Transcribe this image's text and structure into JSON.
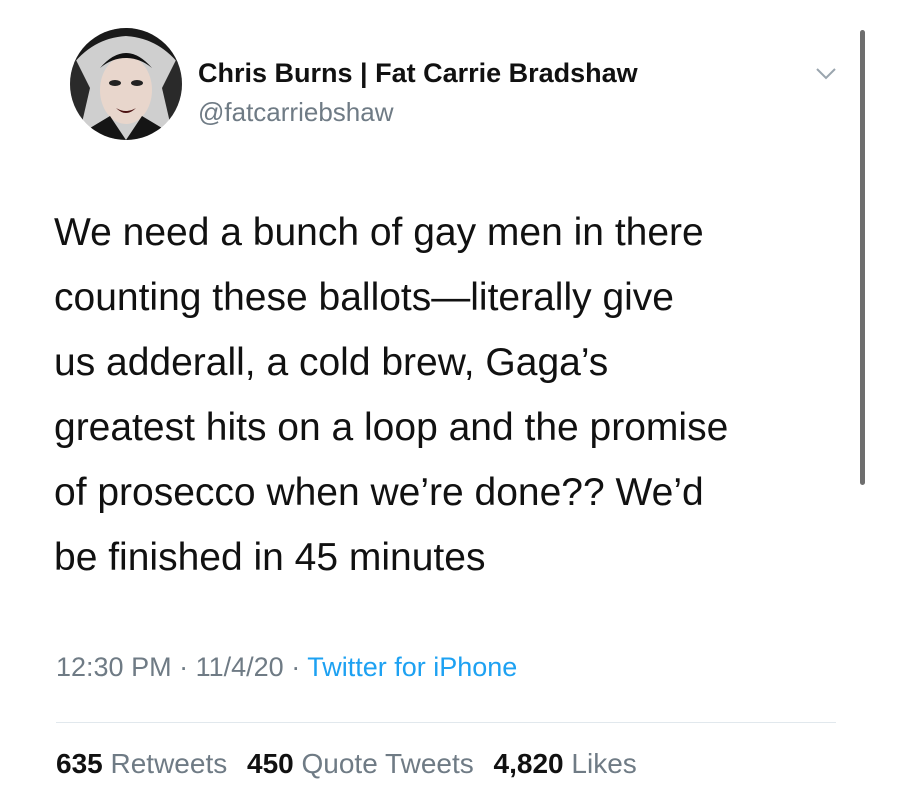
{
  "author": {
    "display_name": "Chris Burns | Fat Carrie Bradshaw",
    "handle": "@fatcarriebshaw"
  },
  "tweet": {
    "lines": [
      "We need a bunch of gay men in there",
      "counting these ballots—literally give",
      "us adderall, a cold brew, Gaga’s",
      "greatest hits on a loop and the promise",
      "of prosecco when we’re done?? We’d",
      "be finished in 45 minutes"
    ]
  },
  "meta": {
    "time": "12:30 PM",
    "separator": "·",
    "date": "11/4/20",
    "source": "Twitter for iPhone"
  },
  "stats": {
    "retweets_count": "635",
    "retweets_label": "Retweets",
    "quote_tweets_count": "450",
    "quote_tweets_label": "Quote Tweets",
    "likes_count": "4,820",
    "likes_label": "Likes"
  },
  "icons": {
    "more": "chevron-down-icon"
  },
  "colors": {
    "link": "#1da1f2",
    "secondary_text": "#6f7b85",
    "divider": "#e1e8ed"
  }
}
